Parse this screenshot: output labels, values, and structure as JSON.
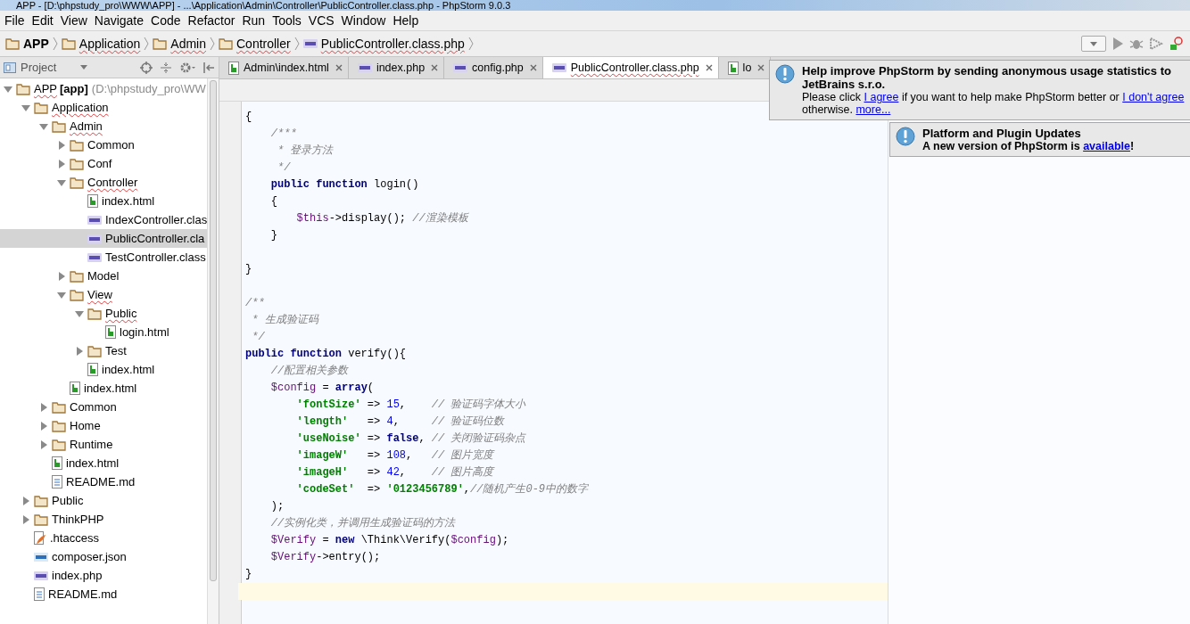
{
  "window": {
    "title": "APP - [D:\\phpstudy_pro\\WWW\\APP] - ...\\Application\\Admin\\Controller\\PublicController.class.php - PhpStorm 9.0.3"
  },
  "menu": [
    "File",
    "Edit",
    "View",
    "Navigate",
    "Code",
    "Refactor",
    "Run",
    "Tools",
    "VCS",
    "Window",
    "Help"
  ],
  "breadcrumb": [
    {
      "label": "APP",
      "kind": "folder"
    },
    {
      "label": "Application",
      "kind": "folder"
    },
    {
      "label": "Admin",
      "kind": "folder"
    },
    {
      "label": "Controller",
      "kind": "folder"
    },
    {
      "label": "PublicController.class.php",
      "kind": "php"
    }
  ],
  "project_panel": {
    "title": "Project",
    "tree": [
      {
        "label": "APP",
        "module": "[app]",
        "path": "(D:\\phpstudy_pro\\WW",
        "kind": "folder",
        "expanded": true,
        "selected": false,
        "children": [
          {
            "label": "Application",
            "kind": "folder",
            "expanded": true,
            "selected": false,
            "children": [
              {
                "label": "Admin",
                "kind": "folder",
                "expanded": true,
                "selected": false,
                "children": [
                  {
                    "label": "Common",
                    "kind": "folder",
                    "expanded": false,
                    "selected": false
                  },
                  {
                    "label": "Conf",
                    "kind": "folder",
                    "expanded": false,
                    "selected": false
                  },
                  {
                    "label": "Controller",
                    "kind": "folder",
                    "expanded": true,
                    "selected": false,
                    "children": [
                      {
                        "label": "index.html",
                        "kind": "html",
                        "selected": false
                      },
                      {
                        "label": "IndexController.clas",
                        "kind": "php",
                        "selected": false
                      },
                      {
                        "label": "PublicController.cla",
                        "kind": "php",
                        "selected": true
                      },
                      {
                        "label": "TestController.class",
                        "kind": "php",
                        "selected": false
                      }
                    ]
                  },
                  {
                    "label": "Model",
                    "kind": "folder",
                    "expanded": false,
                    "selected": false
                  },
                  {
                    "label": "View",
                    "kind": "folder",
                    "expanded": true,
                    "selected": false,
                    "children": [
                      {
                        "label": "Public",
                        "kind": "folder",
                        "expanded": true,
                        "selected": false,
                        "children": [
                          {
                            "label": "login.html",
                            "kind": "html",
                            "selected": false
                          }
                        ]
                      },
                      {
                        "label": "Test",
                        "kind": "folder",
                        "expanded": false,
                        "selected": false
                      },
                      {
                        "label": "index.html",
                        "kind": "html",
                        "selected": false
                      }
                    ]
                  },
                  {
                    "label": "index.html",
                    "kind": "html",
                    "selected": false
                  }
                ]
              },
              {
                "label": "Common",
                "kind": "folder",
                "expanded": false,
                "selected": false
              },
              {
                "label": "Home",
                "kind": "folder",
                "expanded": false,
                "selected": false
              },
              {
                "label": "Runtime",
                "kind": "folder",
                "expanded": false,
                "selected": false
              },
              {
                "label": "index.html",
                "kind": "html",
                "selected": false
              },
              {
                "label": "README.md",
                "kind": "md",
                "selected": false
              }
            ]
          },
          {
            "label": "Public",
            "kind": "folder",
            "expanded": false,
            "selected": false
          },
          {
            "label": "ThinkPHP",
            "kind": "folder",
            "expanded": false,
            "selected": false
          },
          {
            "label": ".htaccess",
            "kind": "htaccess",
            "selected": false
          },
          {
            "label": "composer.json",
            "kind": "json",
            "selected": false
          },
          {
            "label": "index.php",
            "kind": "php",
            "selected": false
          },
          {
            "label": "README.md",
            "kind": "md",
            "selected": false
          }
        ]
      }
    ]
  },
  "tabs": [
    {
      "label": "Admin\\index.html",
      "kind": "html",
      "selected": false
    },
    {
      "label": "index.php",
      "kind": "php",
      "selected": false
    },
    {
      "label": "config.php",
      "kind": "php",
      "selected": false
    },
    {
      "label": "PublicController.class.php",
      "kind": "php",
      "selected": true
    },
    {
      "label": "lo",
      "kind": "html",
      "selected": false
    }
  ],
  "editor": {
    "lines": [
      {
        "current": false,
        "segments": [
          {
            "kind": "plain",
            "text": "{"
          }
        ]
      },
      {
        "current": false,
        "segments": [
          {
            "kind": "comment",
            "text": "    /***"
          }
        ]
      },
      {
        "current": false,
        "segments": [
          {
            "kind": "comment",
            "text": "     * 登录方法"
          }
        ]
      },
      {
        "current": false,
        "segments": [
          {
            "kind": "comment",
            "text": "     */"
          }
        ]
      },
      {
        "current": false,
        "segments": [
          {
            "kind": "keyword",
            "text": "    public function "
          },
          {
            "kind": "plain",
            "text": "login()"
          }
        ]
      },
      {
        "current": false,
        "segments": [
          {
            "kind": "plain",
            "text": "    {"
          }
        ]
      },
      {
        "current": false,
        "segments": [
          {
            "kind": "variable",
            "text": "        $this"
          },
          {
            "kind": "plain",
            "text": "->display(); "
          },
          {
            "kind": "comment",
            "text": "//渲染模板"
          }
        ]
      },
      {
        "current": false,
        "segments": [
          {
            "kind": "plain",
            "text": "    }"
          }
        ]
      },
      {
        "current": false
      },
      {
        "current": false,
        "segments": [
          {
            "kind": "plain",
            "text": "}"
          }
        ]
      },
      {
        "current": false
      },
      {
        "current": false,
        "segments": [
          {
            "kind": "comment",
            "text": "/**"
          }
        ]
      },
      {
        "current": false,
        "segments": [
          {
            "kind": "comment",
            "text": " * 生成验证码"
          }
        ]
      },
      {
        "current": false,
        "segments": [
          {
            "kind": "comment",
            "text": " */"
          }
        ]
      },
      {
        "current": false,
        "segments": [
          {
            "kind": "keyword",
            "text": "public function "
          },
          {
            "kind": "plain",
            "text": "verify(){"
          }
        ]
      },
      {
        "current": false,
        "segments": [
          {
            "kind": "comment",
            "text": "    //配置相关参数"
          }
        ]
      },
      {
        "current": false,
        "segments": [
          {
            "kind": "variable",
            "text": "    $config"
          },
          {
            "kind": "plain",
            "text": " = "
          },
          {
            "kind": "keyword",
            "text": "array"
          },
          {
            "kind": "plain",
            "text": "("
          }
        ]
      },
      {
        "current": false,
        "segments": [
          {
            "kind": "string",
            "text": "        'fontSize'"
          },
          {
            "kind": "plain",
            "text": " => "
          },
          {
            "kind": "number",
            "text": "15"
          },
          {
            "kind": "plain",
            "text": ",    "
          },
          {
            "kind": "comment",
            "text": "// 验证码字体大小"
          }
        ]
      },
      {
        "current": false,
        "segments": [
          {
            "kind": "string",
            "text": "        'length'"
          },
          {
            "kind": "plain",
            "text": "   => "
          },
          {
            "kind": "number",
            "text": "4"
          },
          {
            "kind": "plain",
            "text": ",     "
          },
          {
            "kind": "comment",
            "text": "// 验证码位数"
          }
        ]
      },
      {
        "current": false,
        "segments": [
          {
            "kind": "string",
            "text": "        'useNoise'"
          },
          {
            "kind": "plain",
            "text": " => "
          },
          {
            "kind": "keyword",
            "text": "false"
          },
          {
            "kind": "plain",
            "text": ", "
          },
          {
            "kind": "comment",
            "text": "// 关闭验证码杂点"
          }
        ]
      },
      {
        "current": false,
        "segments": [
          {
            "kind": "string",
            "text": "        'imageW'"
          },
          {
            "kind": "plain",
            "text": "   => "
          },
          {
            "kind": "number",
            "text": "108"
          },
          {
            "kind": "plain",
            "text": ",   "
          },
          {
            "kind": "comment",
            "text": "// 图片宽度"
          }
        ]
      },
      {
        "current": false,
        "segments": [
          {
            "kind": "string",
            "text": "        'imageH'"
          },
          {
            "kind": "plain",
            "text": "   => "
          },
          {
            "kind": "number",
            "text": "42"
          },
          {
            "kind": "plain",
            "text": ",    "
          },
          {
            "kind": "comment",
            "text": "// 图片高度"
          }
        ]
      },
      {
        "current": false,
        "segments": [
          {
            "kind": "string",
            "text": "        'codeSet'"
          },
          {
            "kind": "plain",
            "text": "  => "
          },
          {
            "kind": "string",
            "text": "'0123456789'"
          },
          {
            "kind": "plain",
            "text": ","
          },
          {
            "kind": "comment",
            "text": "//随机产生0-9中的数字"
          }
        ]
      },
      {
        "current": false,
        "segments": [
          {
            "kind": "plain",
            "text": "    );"
          }
        ]
      },
      {
        "current": false,
        "segments": [
          {
            "kind": "comment",
            "text": "    //实例化类，并调用生成验证码的方法"
          }
        ]
      },
      {
        "current": false,
        "segments": [
          {
            "kind": "variable",
            "text": "    $Verify"
          },
          {
            "kind": "plain",
            "text": " = "
          },
          {
            "kind": "keyword",
            "text": "new "
          },
          {
            "kind": "plain",
            "text": "\\Think\\Verify("
          },
          {
            "kind": "variable",
            "text": "$config"
          },
          {
            "kind": "plain",
            "text": ");"
          }
        ]
      },
      {
        "current": false,
        "segments": [
          {
            "kind": "variable",
            "text": "    $Verify"
          },
          {
            "kind": "plain",
            "text": "->entry();"
          }
        ]
      },
      {
        "current": false,
        "segments": [
          {
            "kind": "plain",
            "text": "}"
          }
        ]
      },
      {
        "current": true
      }
    ]
  },
  "notifications": [
    {
      "title": "Help improve PhpStorm by sending anonymous usage statistics to JetBrains s.r.o.",
      "body": [
        {
          "text": "Please click ",
          "link": false
        },
        {
          "text": "I agree",
          "link": true
        },
        {
          "text": " if you want to help make PhpStorm better or ",
          "link": false
        },
        {
          "text": "I don't agree",
          "link": true
        },
        {
          "text": " otherwise. ",
          "link": false
        },
        {
          "text": "more...",
          "link": true
        }
      ]
    },
    {
      "title": "Platform and Plugin Updates",
      "body": [
        {
          "text": "A new version of PhpStorm is ",
          "link": false
        },
        {
          "text": "available",
          "link": true
        },
        {
          "text": "!",
          "link": false
        }
      ]
    }
  ]
}
